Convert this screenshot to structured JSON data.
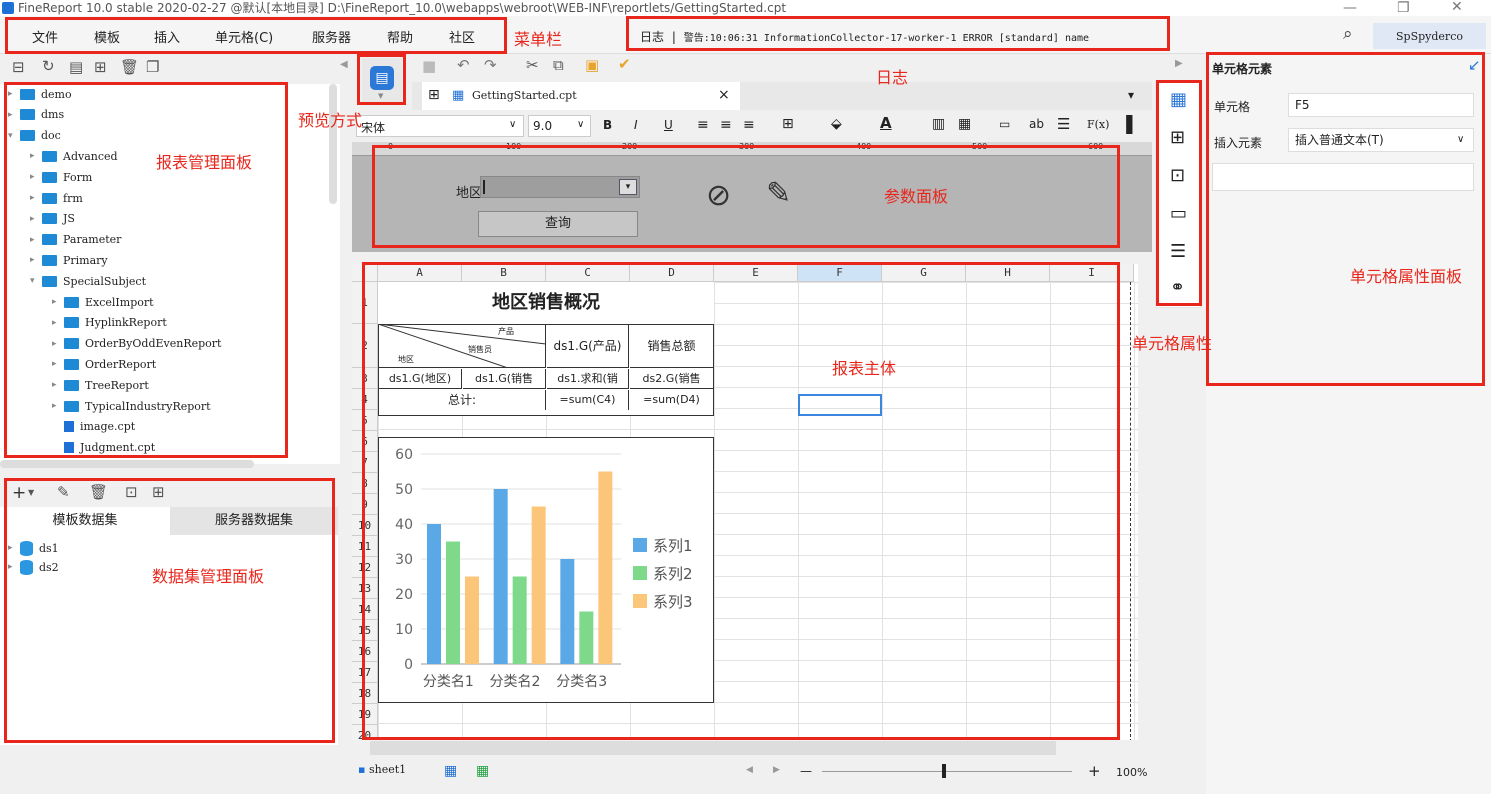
{
  "titlebar": {
    "text": "FineReport 10.0 stable 2020-02-27 @默认[本地目录]   D:\\FineReport_10.0\\webapps\\webroot\\WEB-INF\\reportlets/GettingStarted.cpt"
  },
  "menu": {
    "items": [
      "文件",
      "模板",
      "插入",
      "单元格(C)",
      "服务器",
      "帮助",
      "社区"
    ]
  },
  "log": {
    "label": "日志",
    "separator": "|",
    "message": "警告:10:06:31 InformationCollector-17-worker-1 ERROR [standard] name"
  },
  "user": {
    "name": "SpSpyderco"
  },
  "template_tree": {
    "items": [
      {
        "label": "demo",
        "type": "folder",
        "level": 0,
        "expanded": false
      },
      {
        "label": "dms",
        "type": "folder",
        "level": 0,
        "expanded": false
      },
      {
        "label": "doc",
        "type": "folder",
        "level": 0,
        "expanded": true
      },
      {
        "label": "Advanced",
        "type": "folder",
        "level": 1,
        "expanded": false
      },
      {
        "label": "Form",
        "type": "folder",
        "level": 1,
        "expanded": false
      },
      {
        "label": "frm",
        "type": "folder",
        "level": 1,
        "expanded": false
      },
      {
        "label": "JS",
        "type": "folder",
        "level": 1,
        "expanded": false
      },
      {
        "label": "Parameter",
        "type": "folder",
        "level": 1,
        "expanded": false
      },
      {
        "label": "Primary",
        "type": "folder",
        "level": 1,
        "expanded": false
      },
      {
        "label": "SpecialSubject",
        "type": "folder",
        "level": 1,
        "expanded": true
      },
      {
        "label": "ExcelImport",
        "type": "folder",
        "level": 2,
        "expanded": false
      },
      {
        "label": "HyplinkReport",
        "type": "folder",
        "level": 2,
        "expanded": false
      },
      {
        "label": "OrderByOddEvenReport",
        "type": "folder",
        "level": 2,
        "expanded": false
      },
      {
        "label": "OrderReport",
        "type": "folder",
        "level": 2,
        "expanded": false
      },
      {
        "label": "TreeReport",
        "type": "folder",
        "level": 2,
        "expanded": false
      },
      {
        "label": "TypicalIndustryReport",
        "type": "folder",
        "level": 2,
        "expanded": false
      },
      {
        "label": "image.cpt",
        "type": "file",
        "level": 2
      },
      {
        "label": "Judgment.cpt",
        "type": "file",
        "level": 2
      }
    ]
  },
  "dataset_panel": {
    "tabs": [
      "模板数据集",
      "服务器数据集"
    ],
    "items": [
      "ds1",
      "ds2"
    ]
  },
  "editor_tab": {
    "label": "GettingStarted.cpt",
    "close": "×"
  },
  "format": {
    "font": "宋体",
    "size": "9.0",
    "bold": "B",
    "italic": "I",
    "underline": "U",
    "text_btn": "ab",
    "formula_btn": "F(x)"
  },
  "ruler": {
    "marks": [
      "0",
      "100",
      "200",
      "300",
      "400",
      "500",
      "600"
    ]
  },
  "param_panel": {
    "label": "地区:",
    "button": "查询"
  },
  "sheet": {
    "columns": [
      "A",
      "B",
      "C",
      "D",
      "E",
      "F",
      "G",
      "H",
      "I"
    ],
    "rows": [
      "1",
      "2",
      "3",
      "4",
      "5",
      "6",
      "7",
      "8",
      "9",
      "10",
      "11",
      "12",
      "13",
      "14",
      "15",
      "16",
      "17",
      "18",
      "19",
      "20"
    ],
    "title": "地区销售概况",
    "header_product": "产品",
    "header_sales": "销售员",
    "header_region": "地区",
    "c3": "ds1.G(产品)",
    "d3": "销售总额",
    "a4": "ds1.G(地区)",
    "b4": "ds1.G(销售",
    "c4": "ds1.求和(销",
    "d4": "ds2.G(销售",
    "total_label": "总计:",
    "c5": "=sum(C4)",
    "d5": "=sum(D4)"
  },
  "chart_data": {
    "type": "bar",
    "categories": [
      "分类名1",
      "分类名2",
      "分类名3"
    ],
    "series": [
      {
        "name": "系列1",
        "values": [
          40,
          50,
          30
        ],
        "color": "#5aa8e6"
      },
      {
        "name": "系列2",
        "values": [
          35,
          25,
          15
        ],
        "color": "#7ed98b"
      },
      {
        "name": "系列3",
        "values": [
          25,
          45,
          55
        ],
        "color": "#fbc67a"
      }
    ],
    "ylim": [
      0,
      60
    ],
    "yticks": [
      "0",
      "10",
      "20",
      "30",
      "40",
      "50",
      "60"
    ],
    "grid": true,
    "legend": "right"
  },
  "sheet_tabs": {
    "sheet": "sheet1"
  },
  "zoom": {
    "minus": "—",
    "plus": "+",
    "level": "100%"
  },
  "cell_panel": {
    "title": "单元格元素",
    "cell_label": "单元格",
    "cell_value": "F5",
    "insert_label": "插入元素",
    "insert_value": "插入普通文本(T)"
  },
  "annotations": {
    "menubar": "菜单栏",
    "log": "日志",
    "preview": "预览方式",
    "report_mgmt": "报表管理面板",
    "param_panel": "参数面板",
    "cell_attr_panel": "单元格属性面板",
    "cell_attr": "单元格属性",
    "report_body": "报表主体",
    "dataset_mgmt": "数据集管理面板"
  },
  "colors": {
    "accent": "#e8261c",
    "selection": "#3c86e0",
    "folder": "#1e8ad6"
  }
}
